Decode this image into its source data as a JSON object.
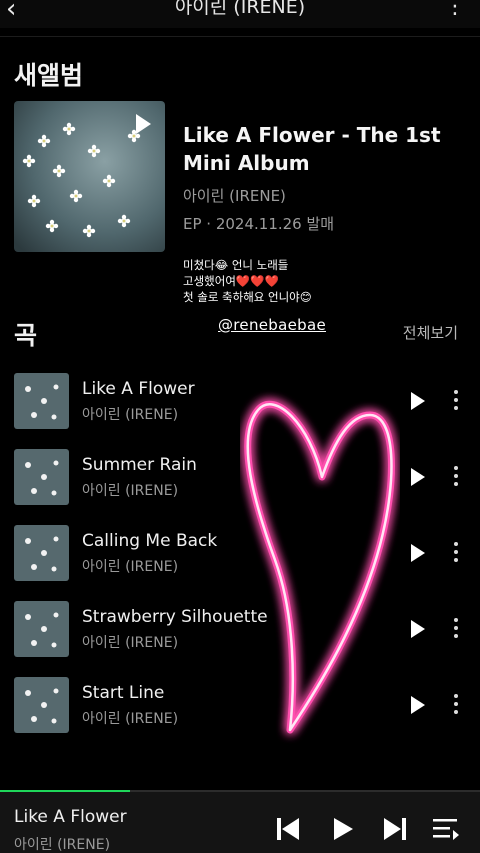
{
  "header": {
    "title": "아이린 (IRENE)",
    "back_icon": "chevron-left-icon",
    "more_icon": "more-vertical-icon"
  },
  "new_album": {
    "section_title": "새앨범",
    "title": "Like A Flower - The 1st Mini Album",
    "artist": "아이린 (IRENE)",
    "meta": "EP · 2024.11.26 발매"
  },
  "sticker": {
    "text": "미쳤다😂 언니 노래들\n고생했어여❤️❤️❤️\n첫 솔로 축하해요 언니야😊",
    "tag": "@renebaebae"
  },
  "songs": {
    "section_title": "곡",
    "see_all": "전체보기",
    "items": [
      {
        "title": "Like A Flower",
        "artist": "아이린 (IRENE)"
      },
      {
        "title": "Summer Rain",
        "artist": "아이린 (IRENE)"
      },
      {
        "title": "Calling Me Back",
        "artist": "아이린 (IRENE)"
      },
      {
        "title": "Strawberry Silhouette",
        "artist": "아이린 (IRENE)"
      },
      {
        "title": "Start Line",
        "artist": "아이린 (IRENE)"
      }
    ]
  },
  "player": {
    "title": "Like A Flower",
    "artist": "아이린 (IRENE)",
    "progress": 0.27
  },
  "colors": {
    "accent": "#1fd65a",
    "background": "#000000",
    "heart_neon": "#ff4fae"
  }
}
